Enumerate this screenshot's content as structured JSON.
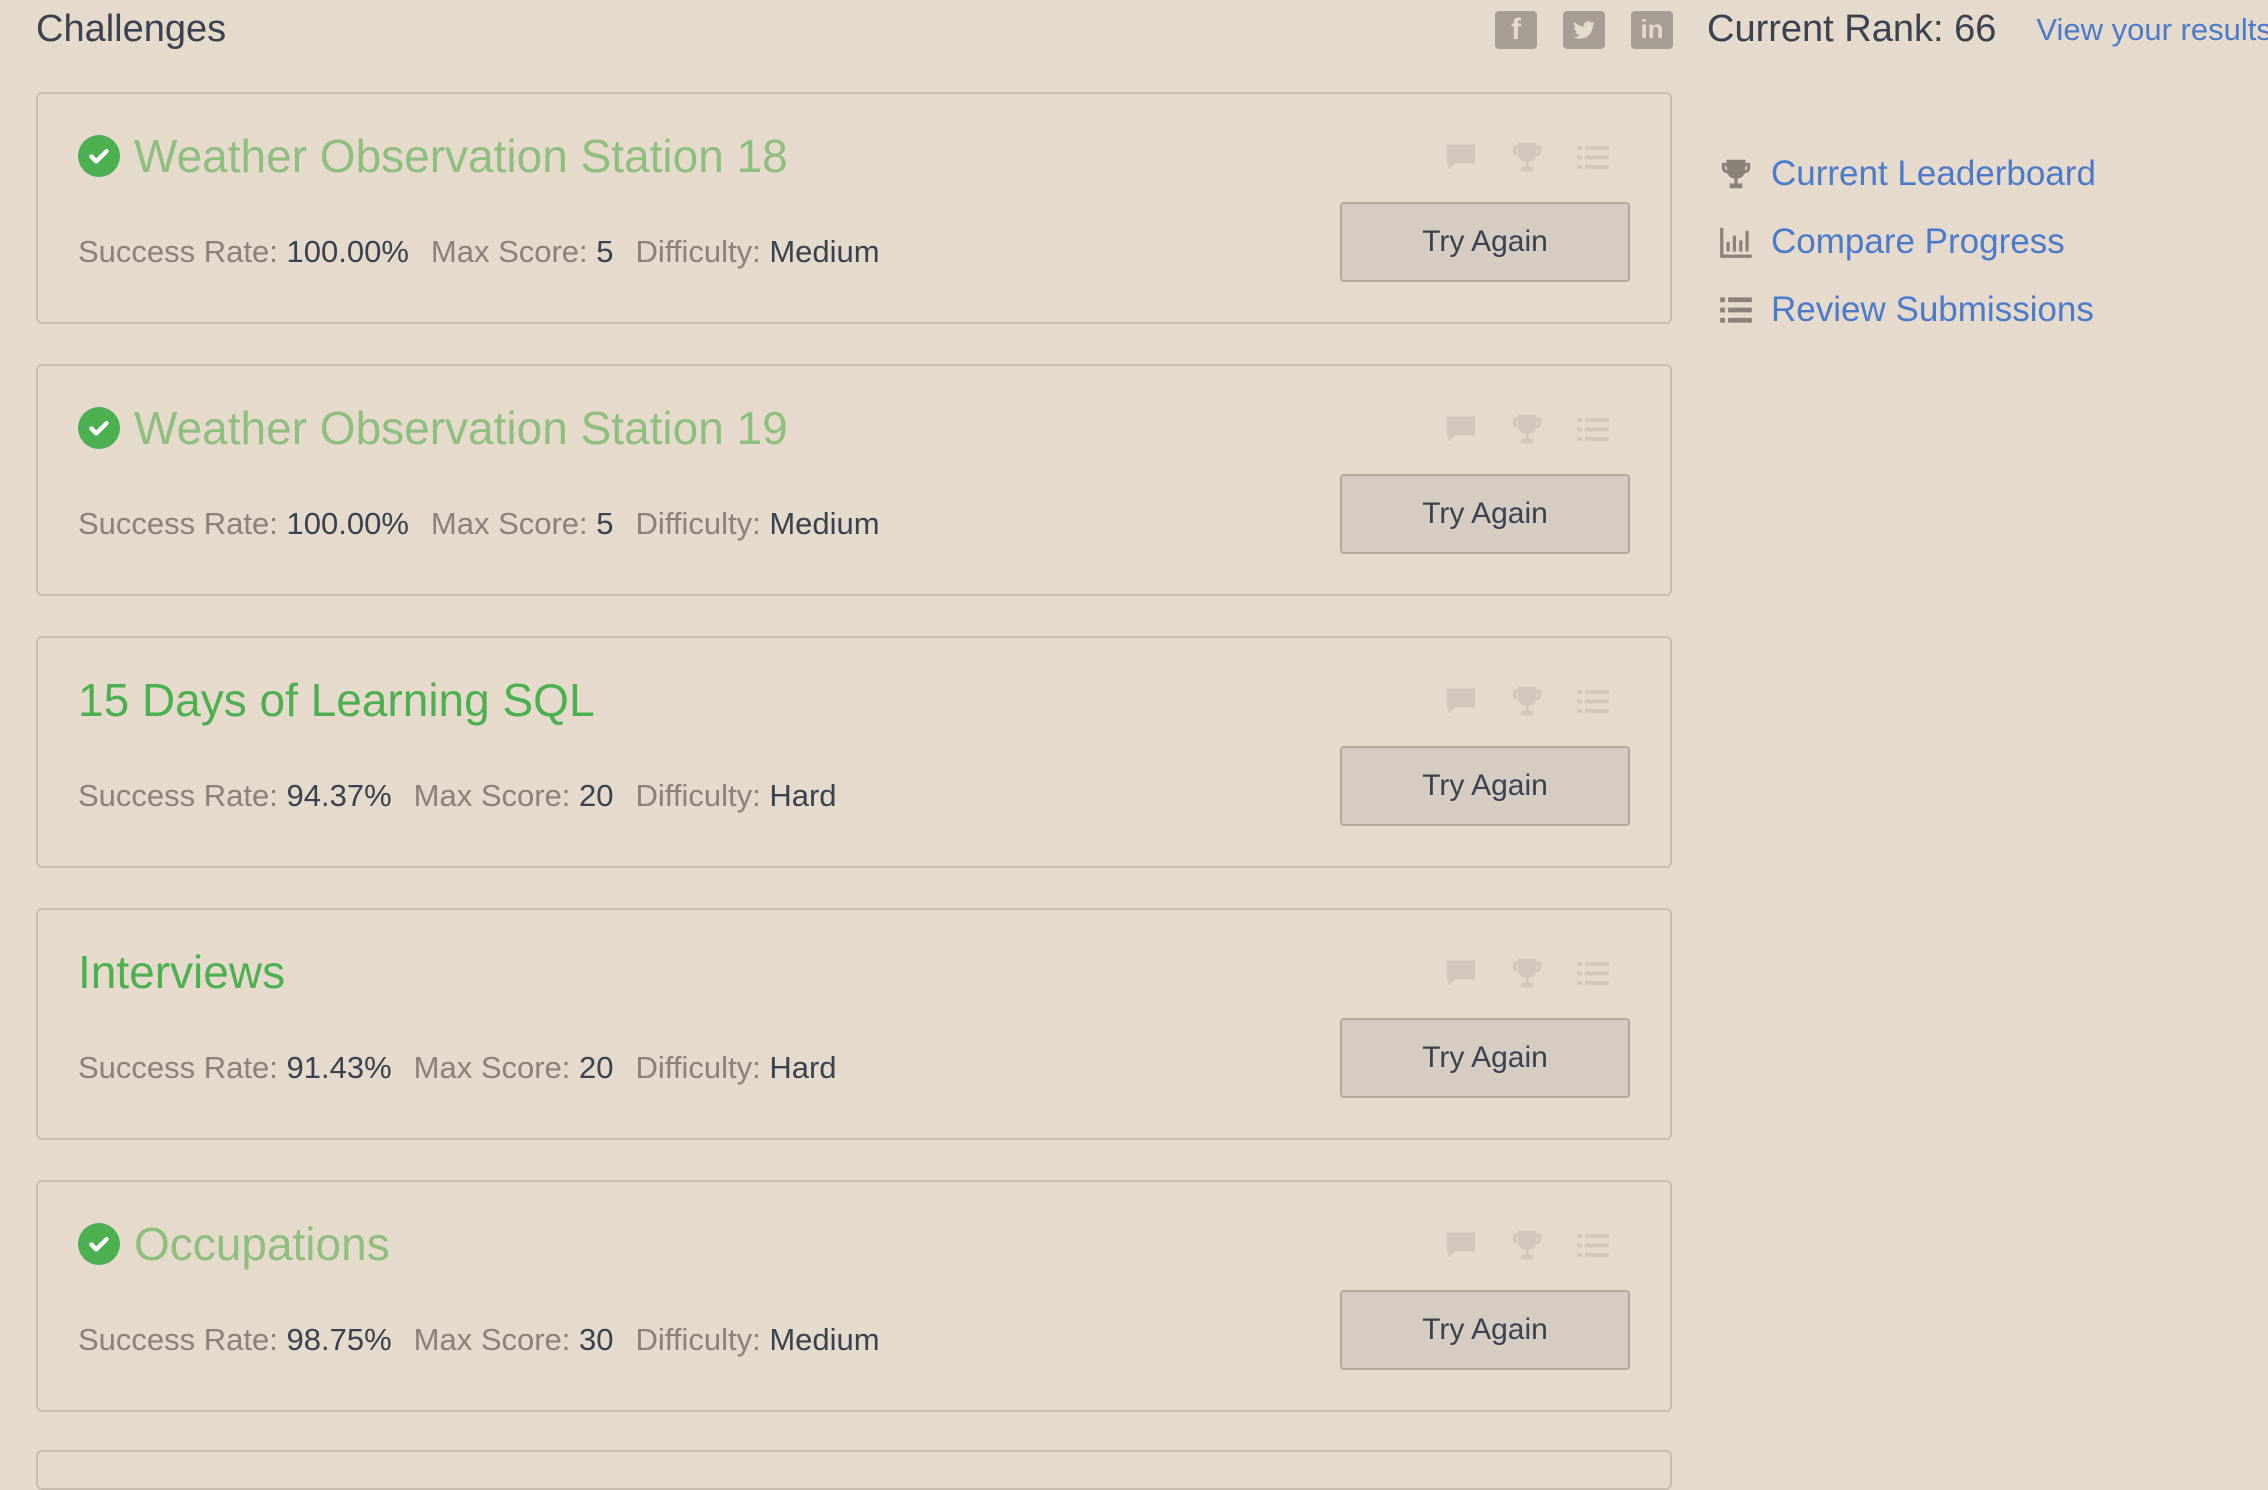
{
  "header": {
    "title": "Challenges",
    "rank_text": "Current Rank: 66",
    "view_results": "View your results",
    "social": [
      {
        "icon": "facebook-icon",
        "glyph": "f"
      },
      {
        "icon": "twitter-icon",
        "glyph": ""
      },
      {
        "icon": "linkedin-icon",
        "glyph": "in"
      }
    ]
  },
  "labels": {
    "success_rate": "Success Rate:",
    "max_score": "Max Score:",
    "difficulty": "Difficulty:",
    "try_again": "Try Again"
  },
  "challenges": [
    {
      "title": "Weather Observation Station 18",
      "solved": true,
      "success_rate": "100.00%",
      "max_score": "5",
      "difficulty": "Medium"
    },
    {
      "title": "Weather Observation Station 19",
      "solved": true,
      "success_rate": "100.00%",
      "max_score": "5",
      "difficulty": "Medium"
    },
    {
      "title": "15 Days of Learning SQL",
      "solved": false,
      "success_rate": "94.37%",
      "max_score": "20",
      "difficulty": "Hard"
    },
    {
      "title": "Interviews",
      "solved": false,
      "success_rate": "91.43%",
      "max_score": "20",
      "difficulty": "Hard"
    },
    {
      "title": "Occupations",
      "solved": true,
      "success_rate": "98.75%",
      "max_score": "30",
      "difficulty": "Medium"
    }
  ],
  "sidebar": {
    "links": [
      {
        "label": "Current Leaderboard",
        "icon": "trophy-icon"
      },
      {
        "label": "Compare Progress",
        "icon": "bar-chart-icon"
      },
      {
        "label": "Review Submissions",
        "icon": "list-icon"
      }
    ]
  },
  "colors": {
    "background": "#e6dacd",
    "link": "#4a7ac9",
    "solved_title": "#8fbf7f",
    "unsolved_title": "#4caf50",
    "check": "#4caf50"
  }
}
